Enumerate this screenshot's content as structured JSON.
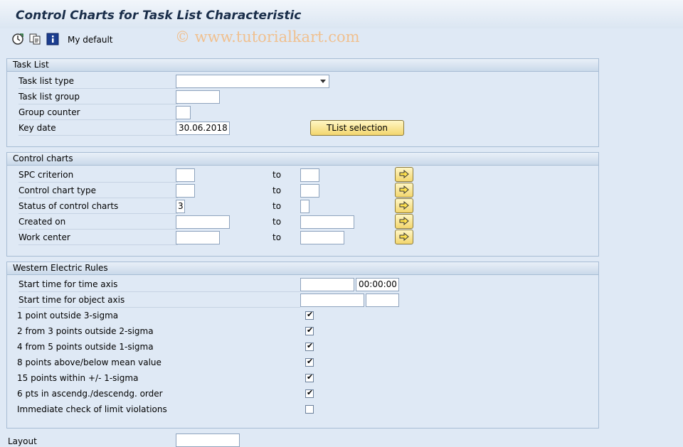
{
  "window": {
    "title": "Control Charts for Task List Characteristic"
  },
  "toolbar": {
    "variant_label": "My default",
    "icons": [
      "execute-icon",
      "copy-icon",
      "info-icon"
    ]
  },
  "watermark": "© www.tutorialkart.com",
  "task_list": {
    "title": "Task List",
    "type_label": "Task list type",
    "type_value": "",
    "group_label": "Task list group",
    "group_value": "",
    "counter_label": "Group counter",
    "counter_value": "",
    "key_date_label": "Key date",
    "key_date_value": "30.06.2018",
    "tlist_button": "TList selection"
  },
  "control_charts": {
    "title": "Control charts",
    "to_label": "to",
    "rows": [
      {
        "label": "SPC criterion",
        "from": "",
        "to": ""
      },
      {
        "label": "Control chart type",
        "from": "",
        "to": ""
      },
      {
        "label": "Status of control charts",
        "from": "3",
        "to": ""
      },
      {
        "label": "Created on",
        "from": "",
        "to": ""
      },
      {
        "label": "Work center",
        "from": "",
        "to": ""
      }
    ]
  },
  "western": {
    "title": "Western Electric Rules",
    "start_time_axis_label": "Start time for time axis",
    "start_time_axis_date": "",
    "start_time_axis_time": "00:00:00",
    "start_object_axis_label": "Start time for object axis",
    "start_object_axis_date": "",
    "start_object_axis_time": "",
    "rules": [
      {
        "label": "1 point outside 3-sigma",
        "checked": true,
        "mark": "✔"
      },
      {
        "label": "2 from 3 points outside 2-sigma",
        "checked": true,
        "mark": "✔"
      },
      {
        "label": "4 from 5 points outside 1-sigma",
        "checked": true,
        "mark": "✔"
      },
      {
        "label": "8 points above/below mean value",
        "checked": true,
        "mark": "✔"
      },
      {
        "label": "15 points within +/- 1-sigma",
        "checked": true,
        "mark": "✔"
      },
      {
        "label": "6 pts in ascendg./descendg. order",
        "checked": true,
        "mark": "✔"
      },
      {
        "label": "Immediate check of limit violations",
        "checked": false,
        "mark": ""
      }
    ]
  },
  "layout": {
    "label": "Layout",
    "value": ""
  }
}
